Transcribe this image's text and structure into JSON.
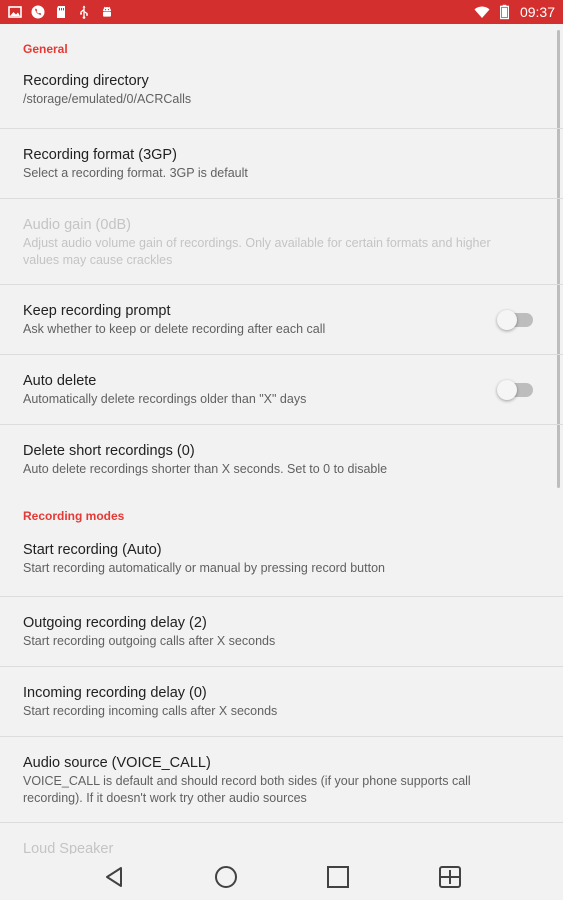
{
  "status_bar": {
    "time": "09:37",
    "left_icons": [
      "image-icon",
      "phone-circle-icon",
      "sd-card-icon",
      "usb-icon",
      "android-icon"
    ],
    "right_icons": [
      "wifi-icon",
      "battery-icon"
    ],
    "color": "#d32f2f"
  },
  "sections": {
    "general": "General",
    "recording_modes": "Recording modes"
  },
  "prefs": {
    "recording_directory": {
      "title": "Recording directory",
      "summary": "/storage/emulated/0/ACRCalls"
    },
    "recording_format": {
      "title": "Recording format (3GP)",
      "summary": "Select a recording format. 3GP is default"
    },
    "audio_gain": {
      "title": "Audio gain (0dB)",
      "summary": "Adjust audio volume gain of recordings. Only available for certain formats and higher values may cause crackles",
      "enabled": false
    },
    "keep_recording_prompt": {
      "title": "Keep recording prompt",
      "summary": "Ask whether to keep or delete recording after each call",
      "checked": false
    },
    "auto_delete": {
      "title": "Auto delete",
      "summary": "Automatically delete recordings older than \"X\" days",
      "checked": false
    },
    "delete_short": {
      "title": "Delete short recordings (0)",
      "summary": "Auto delete recordings shorter than X seconds. Set to 0 to disable"
    },
    "start_recording": {
      "title": "Start recording (Auto)",
      "summary": "Start recording automatically or manual by pressing record button"
    },
    "outgoing_delay": {
      "title": "Outgoing recording delay (2)",
      "summary": "Start recording outgoing calls after X seconds"
    },
    "incoming_delay": {
      "title": "Incoming recording delay (0)",
      "summary": "Start recording incoming calls after X seconds"
    },
    "audio_source": {
      "title": "Audio source (VOICE_CALL)",
      "summary": "VOICE_CALL is default and should record both sides (if your phone supports call recording). If it doesn't work try other audio sources"
    },
    "loud_speaker": {
      "title": "Loud Speaker",
      "enabled": false
    }
  },
  "accent_color": "#e53935",
  "nav_bar": [
    "back-icon",
    "home-icon",
    "recents-icon",
    "split-screen-icon"
  ]
}
